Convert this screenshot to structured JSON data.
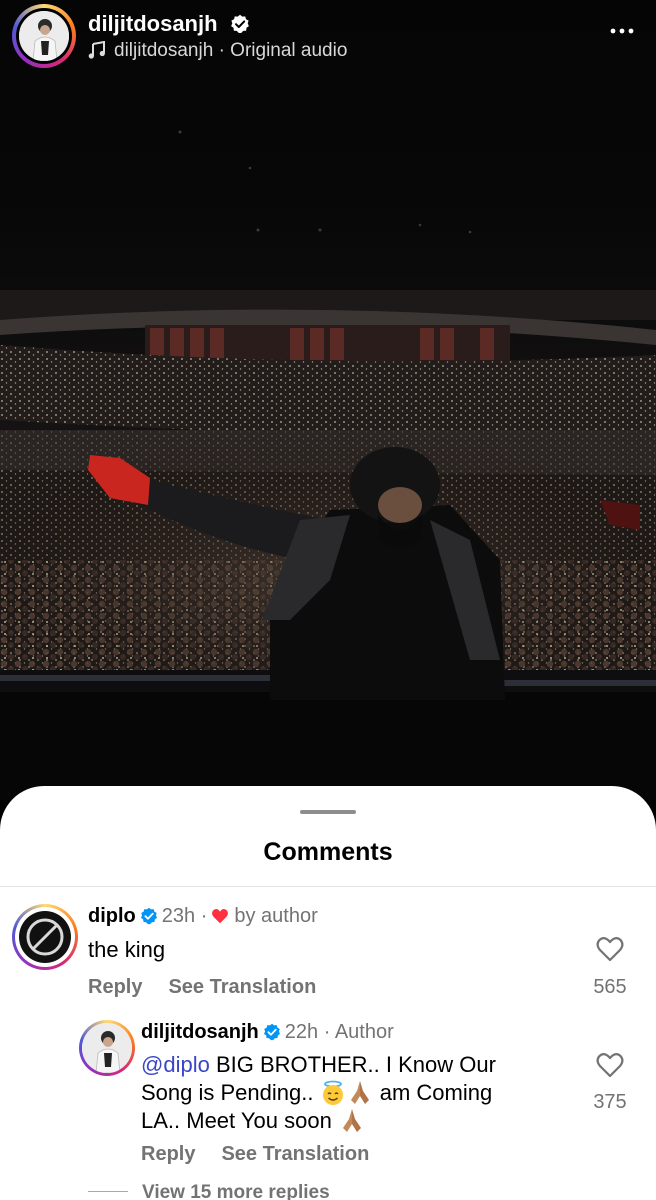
{
  "header": {
    "username": "diljitdosanjh",
    "audio_label": "diljitdosanjh · Original audio",
    "icons": [
      "verified-badge-icon",
      "music-note-icon",
      "more-options-icon"
    ]
  },
  "comments_panel": {
    "title": "Comments",
    "comments": [
      {
        "username": "diplo",
        "time": "23h",
        "liked_by_author_label": "by author",
        "text": "the king",
        "reply_label": "Reply",
        "translate_label": "See Translation",
        "like_count": "565"
      }
    ],
    "reply": {
      "username": "diljitdosanjh",
      "time": "22h",
      "role": "Author",
      "mention": "@diplo",
      "text_line1": "BIG BROTHER.. I Know Our",
      "text_line2_a": "Song is Pending..",
      "text_line2_b": "am Coming",
      "text_line3": "LA.. Meet You soon",
      "reply_label": "Reply",
      "translate_label": "See Translation",
      "like_count": "375"
    },
    "view_more_replies": "View 15 more replies"
  },
  "colors": {
    "mention": "#3a45c7",
    "heart_red": "#ff3040",
    "verified_blue": "#0095f6",
    "secondary_text": "#737373"
  }
}
